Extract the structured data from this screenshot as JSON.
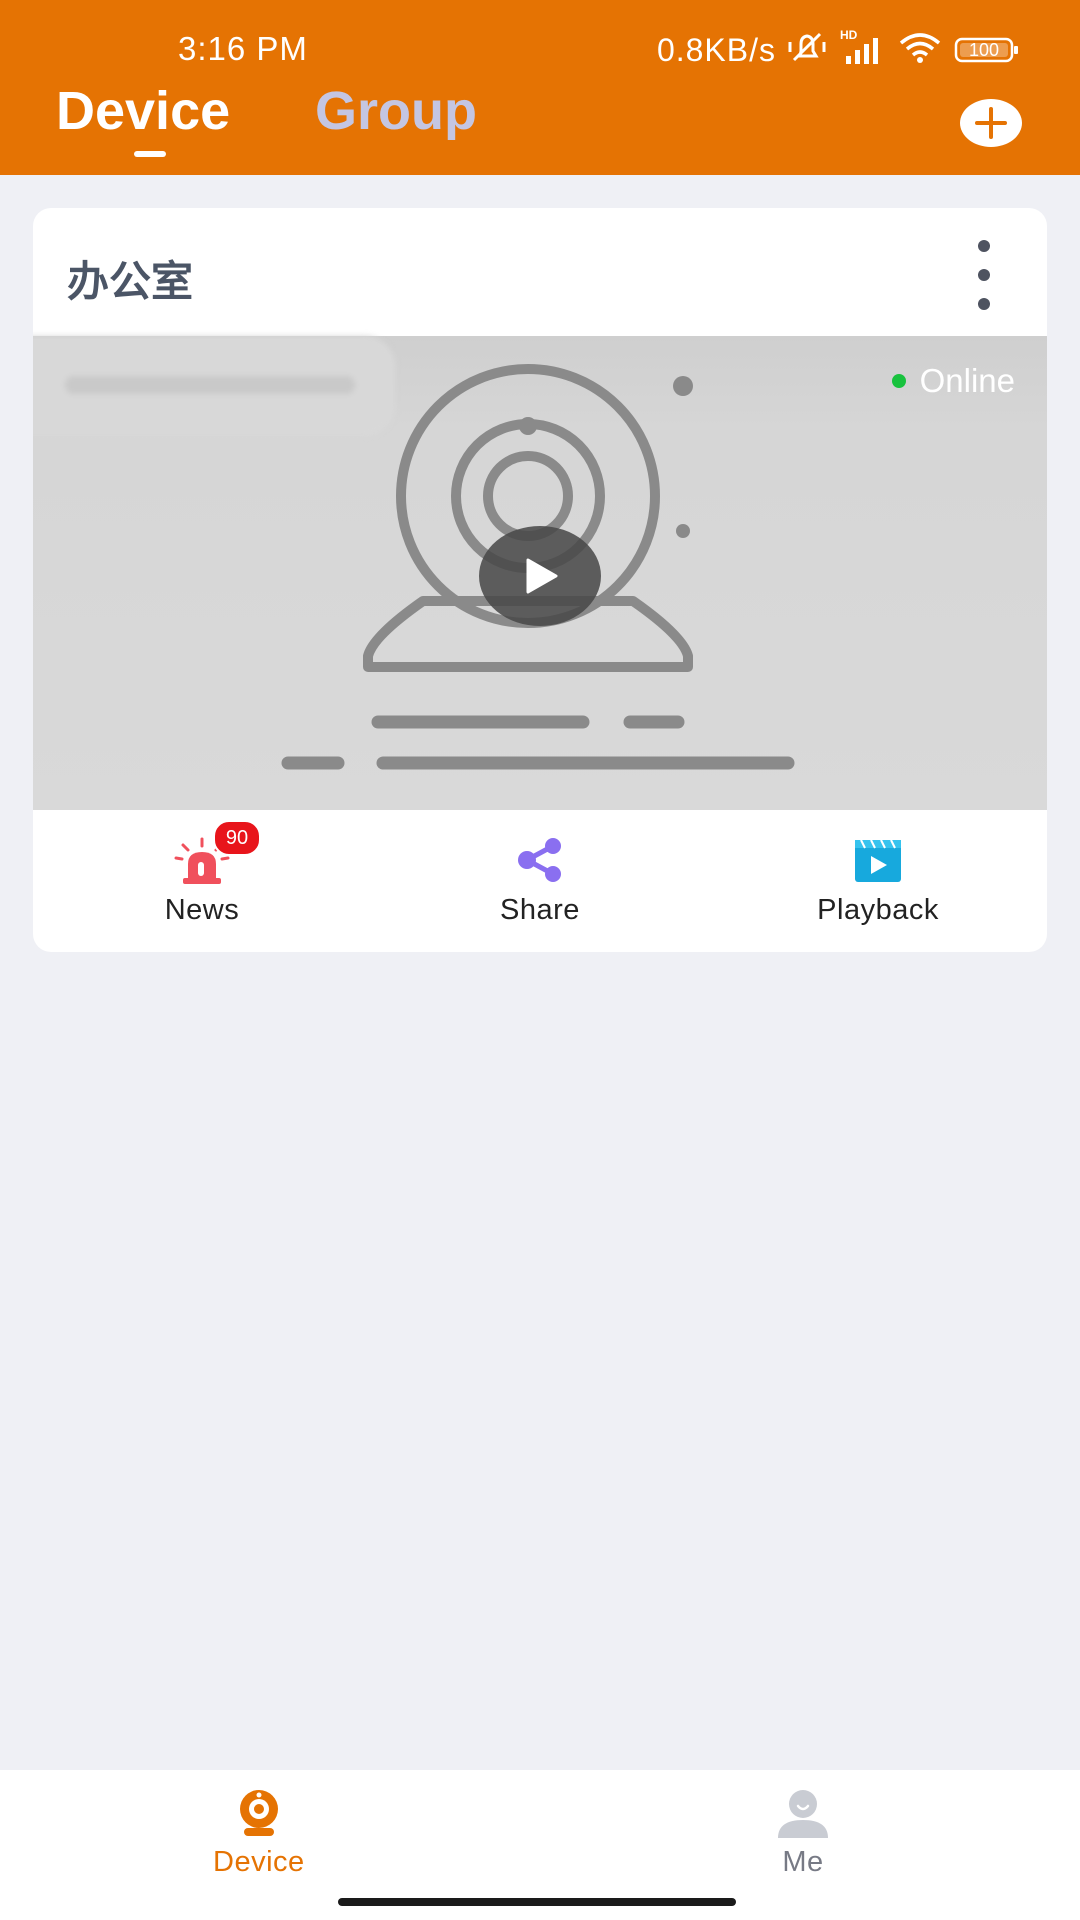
{
  "status_bar": {
    "time": "3:16 PM",
    "net_speed": "0.8KB/s",
    "signal_tag": "HD",
    "battery": "100"
  },
  "header": {
    "tabs": [
      {
        "label": "Device",
        "active": true
      },
      {
        "label": "Group",
        "active": false
      }
    ],
    "add_icon": "plus-circle-icon"
  },
  "device_card": {
    "name": "办公室",
    "status": "Online",
    "status_color": "#18c23e",
    "actions": [
      {
        "label": "News",
        "icon": "alarm-siren-icon",
        "badge": "90"
      },
      {
        "label": "Share",
        "icon": "share-icon"
      },
      {
        "label": "Playback",
        "icon": "video-playback-icon"
      }
    ]
  },
  "bottom_nav": {
    "items": [
      {
        "label": "Device",
        "icon": "camera-icon",
        "active": true
      },
      {
        "label": "Me",
        "icon": "user-icon",
        "active": false
      }
    ]
  },
  "colors": {
    "accent": "#e57303",
    "background": "#eff0f5",
    "inactive_tab": "#c4c6e2",
    "badge": "#e8151b"
  }
}
